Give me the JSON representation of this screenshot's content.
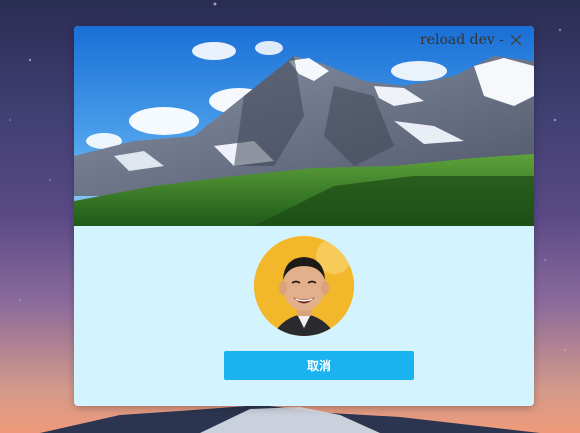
{
  "window": {
    "title": "reload dev -",
    "close_icon": "close-icon"
  },
  "dialog": {
    "background": "#d3f3ff",
    "banner_image": "mountain-landscape",
    "avatar_image": "user-avatar-photo",
    "cancel_label": "取消",
    "accent_color": "#1ab3f0"
  },
  "desktop": {
    "wallpaper": "starry-sky-mountain"
  }
}
